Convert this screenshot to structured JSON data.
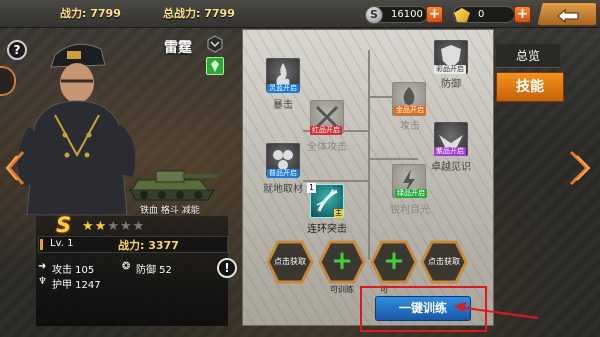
{
  "topbar": {
    "power_label": "战力: 7799",
    "total_power_label": "总战力: 7799",
    "silver": "16100",
    "gold": "0",
    "plus": "+"
  },
  "hero": {
    "name": "雷霆",
    "rank": "S",
    "stars_filled": 2,
    "stars_total": 5,
    "tank_tags": "铁血 格斗 减能",
    "level": "Lv. 1",
    "battle_power": "战力: 3377",
    "attack": "攻击 105",
    "defense": "防御 52",
    "armor": "护甲 1247",
    "help": "?",
    "info": "!"
  },
  "skills": {
    "crit": {
      "tag": "灵蓝开启",
      "name": "暴击"
    },
    "defense": {
      "tag": "彩品开启",
      "name": "防御"
    },
    "full_attack": {
      "tag": "红品开启",
      "name": "全体攻击"
    },
    "attack": {
      "tag": "金品开启",
      "name": "攻击"
    },
    "ground": {
      "tag": "普品开启",
      "name": "就地取材"
    },
    "vision": {
      "tag": "紫品开启",
      "name": "卓越见识"
    },
    "sharp": {
      "tag": "绿品开启",
      "name": "锐利目光"
    },
    "combo": {
      "name": "连环突击",
      "level": "1",
      "main": "主"
    }
  },
  "slots": {
    "get1": "点击获取",
    "get2": "点击获取",
    "trainable1": "可训练",
    "trainable2": "可",
    "plus": "+"
  },
  "train_button": "一键训练",
  "tabs": {
    "overview": "总览",
    "skill": "技能"
  }
}
